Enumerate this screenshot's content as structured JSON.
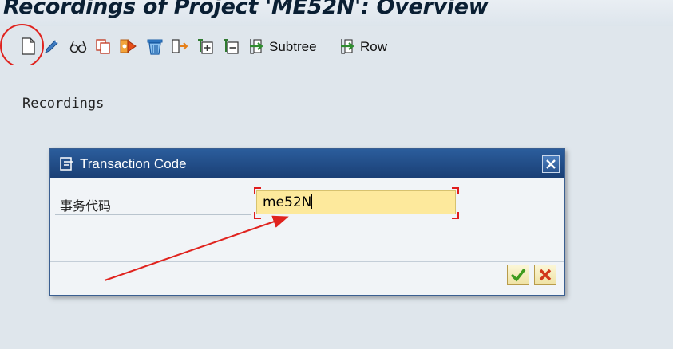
{
  "window": {
    "title": "Recordings of Project 'ME52N': Overview"
  },
  "toolbar": {
    "icons": [
      "new-document-icon",
      "edit-pencil-icon",
      "glasses-display-icon",
      "copy-icon",
      "execute-process-icon",
      "delete-trash-icon",
      "transfer-icon",
      "expand-subtree-icon",
      "collapse-subtree-icon",
      "subtree-icon",
      "row-icon"
    ],
    "subtree_label": "Subtree",
    "row_label": "Row"
  },
  "main": {
    "section_label": "Recordings"
  },
  "dialog": {
    "title": "Transaction Code",
    "field_label": "事务代码",
    "field_value": "me52N",
    "confirm_icon": "checkmark-icon",
    "cancel_icon": "cancel-x-icon",
    "close_icon": "close-icon"
  },
  "colors": {
    "highlight": "#e0231e",
    "dialog_header": "#1f4a85",
    "input_bg": "#fde99c"
  }
}
